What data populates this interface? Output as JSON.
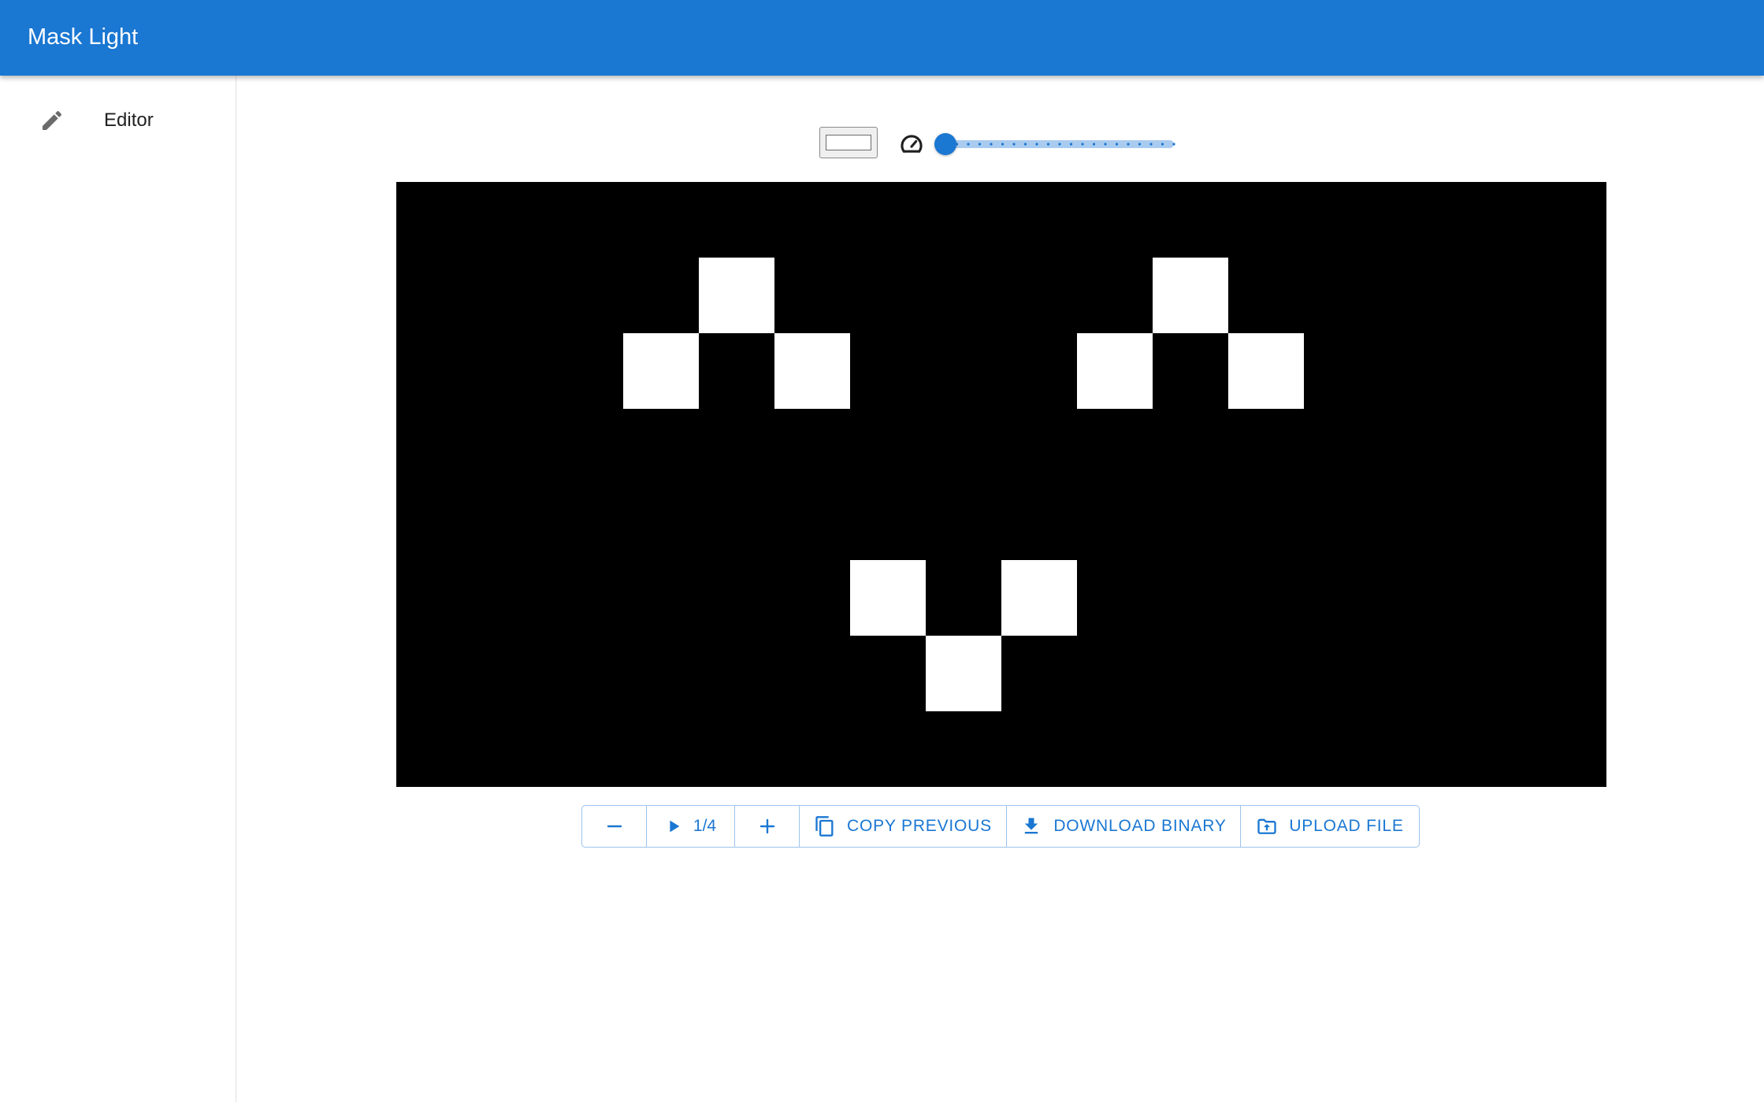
{
  "appbar": {
    "title": "Mask Light",
    "color": "#1a77d2"
  },
  "drawer": {
    "items": [
      {
        "label": "Editor",
        "icon": "pencil-icon"
      }
    ]
  },
  "toolbar": {
    "color_picker_value": "#ffffff",
    "speed_icon": "speedometer-icon",
    "speed_slider": {
      "value": 0,
      "min": 0,
      "max": 20,
      "step": 1
    }
  },
  "canvas": {
    "columns": 16,
    "rows": 8,
    "background": "#000000",
    "on_color": "#ffffff",
    "lit_cells": [
      [
        4,
        1
      ],
      [
        3,
        2
      ],
      [
        5,
        2
      ],
      [
        10,
        1
      ],
      [
        9,
        2
      ],
      [
        11,
        2
      ],
      [
        6,
        5
      ],
      [
        8,
        5
      ],
      [
        7,
        6
      ]
    ]
  },
  "controls": {
    "remove_frame_icon": "minus-icon",
    "play_icon": "play-icon",
    "frame_indicator": "1/4",
    "add_frame_icon": "plus-icon",
    "copy_previous_label": "Copy previous",
    "copy_previous_icon": "copy-icon",
    "download_label": "Download binary",
    "download_icon": "download-icon",
    "upload_label": "Upload file",
    "upload_icon": "folder-upload-icon"
  }
}
